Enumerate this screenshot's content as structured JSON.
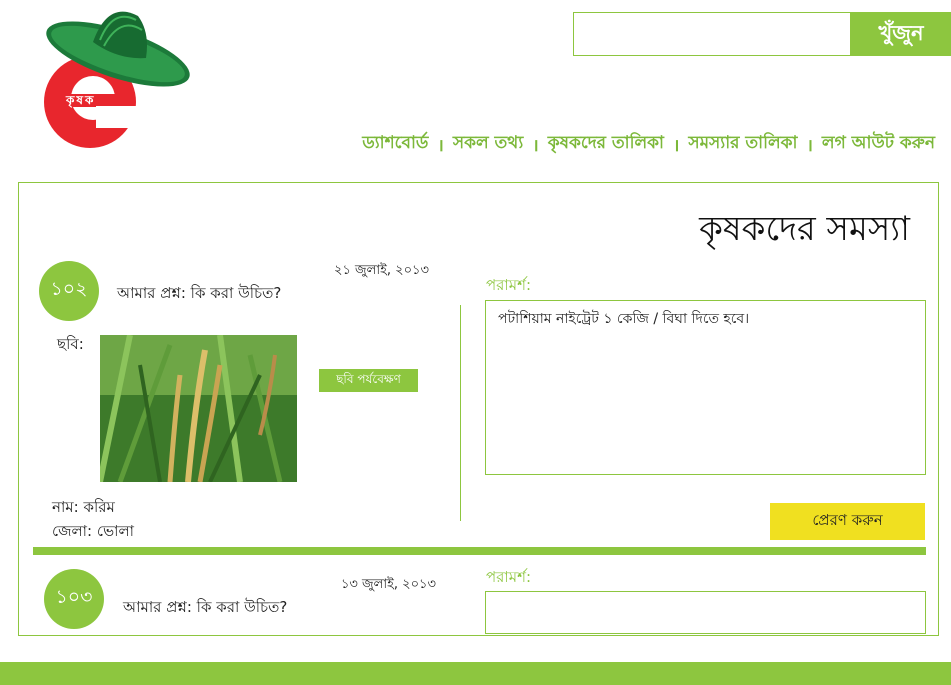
{
  "brand": {
    "logo_letter": "e",
    "logo_text": "কৃষক",
    "colors": {
      "accent": "#8dc63f",
      "logo_red": "#e8262d",
      "hat_green": "#1c7a3a",
      "button_yellow": "#f0e020"
    }
  },
  "search": {
    "placeholder": "",
    "value": "",
    "button_label": "খুঁজুন"
  },
  "nav": {
    "items": [
      {
        "label": "ড্যাশবোর্ড"
      },
      {
        "label": "সকল তথ্য"
      },
      {
        "label": "কৃষকদের তালিকা"
      },
      {
        "label": "সমস্যার তালিকা"
      },
      {
        "label": "লগ আউট করুন"
      }
    ],
    "separator": "।"
  },
  "page": {
    "title": "কৃষকদের সমস্যা"
  },
  "problems": [
    {
      "id": "১০২",
      "question": "আমার প্রশ্ন: কি করা উচিত?",
      "date": "২১ জুলাই, ২০১৩",
      "photo_label": "ছবি:",
      "view_photo_label": "ছবি পর্যবেক্ষণ",
      "name_line": "নাম: করিম",
      "district_line": "জেলা: ভোলা",
      "advice_label": "পরামর্শ:",
      "advice_text": "পটাশিয়াম নাইট্রেট ১ কেজি / বিঘা দিতে হবে।",
      "send_label": "প্রেরণ করুন"
    },
    {
      "id": "১০৩",
      "question": "আমার প্রশ্ন: কি করা উচিত?",
      "date": "১৩ জুলাই, ২০১৩",
      "advice_label": "পরামর্শ:",
      "advice_text": ""
    }
  ]
}
